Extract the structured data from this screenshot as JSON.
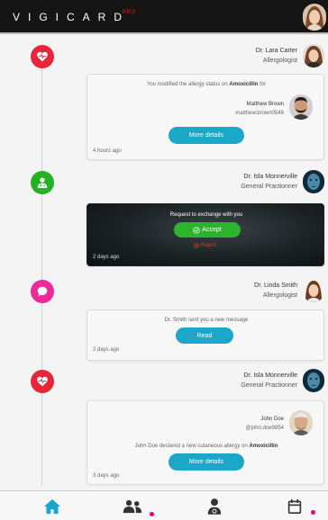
{
  "app": {
    "brand": "VIGICARD",
    "brand_suffix": "PRO"
  },
  "colors": {
    "red": "#e8253a",
    "green": "#25b025",
    "pink": "#ec2a9b",
    "teal": "#1ba8c8",
    "accept_green": "#2cb52c",
    "reject_red": "#e23434",
    "nav_blue": "#1aa5c9",
    "notification_dot": "#e6006e"
  },
  "timeline": [
    {
      "icon": "heart-pulse-icon",
      "doctor_name": "Dr. Lara Carter",
      "doctor_role": "Allergologist",
      "card": {
        "message_prefix": "You modified the allergy status on",
        "message_drug": "Amoxicillin",
        "message_suffix": "for",
        "patient_name": "Matthew Brown",
        "patient_handle": "matthew.brown0546",
        "button": "More details",
        "time": "4 hours ago"
      }
    },
    {
      "icon": "user-doctor-icon",
      "doctor_name": "Dr. Isla Monnerville",
      "doctor_role": "General Practionner",
      "card": {
        "message": "Request to exchange with you",
        "accept": "Accept",
        "reject": "Reject",
        "time": "2 days ago"
      }
    },
    {
      "icon": "chat-bubble-icon",
      "doctor_name": "Dr. Linda Smith",
      "doctor_role": "Allergologist",
      "card": {
        "message": "Dr. Smith sent you a new message",
        "button": "Read",
        "time": "2 days ago"
      }
    },
    {
      "icon": "heart-pulse-icon",
      "doctor_name": "Dr. Isla Monnerville",
      "doctor_role": "General Practionner",
      "card": {
        "patient_name": "John Doe",
        "patient_handle": "@john.doe9854",
        "message_prefix": "John Doe declared a new cutaneous allergy on",
        "message_drug": "Amoxicillin",
        "button": "More details",
        "time": "3 days ago"
      }
    }
  ],
  "nav": [
    {
      "icon": "home-icon",
      "active": true
    },
    {
      "icon": "users-icon",
      "notification": true
    },
    {
      "icon": "doctor-icon"
    },
    {
      "icon": "calendar-icon",
      "notification": true
    }
  ]
}
